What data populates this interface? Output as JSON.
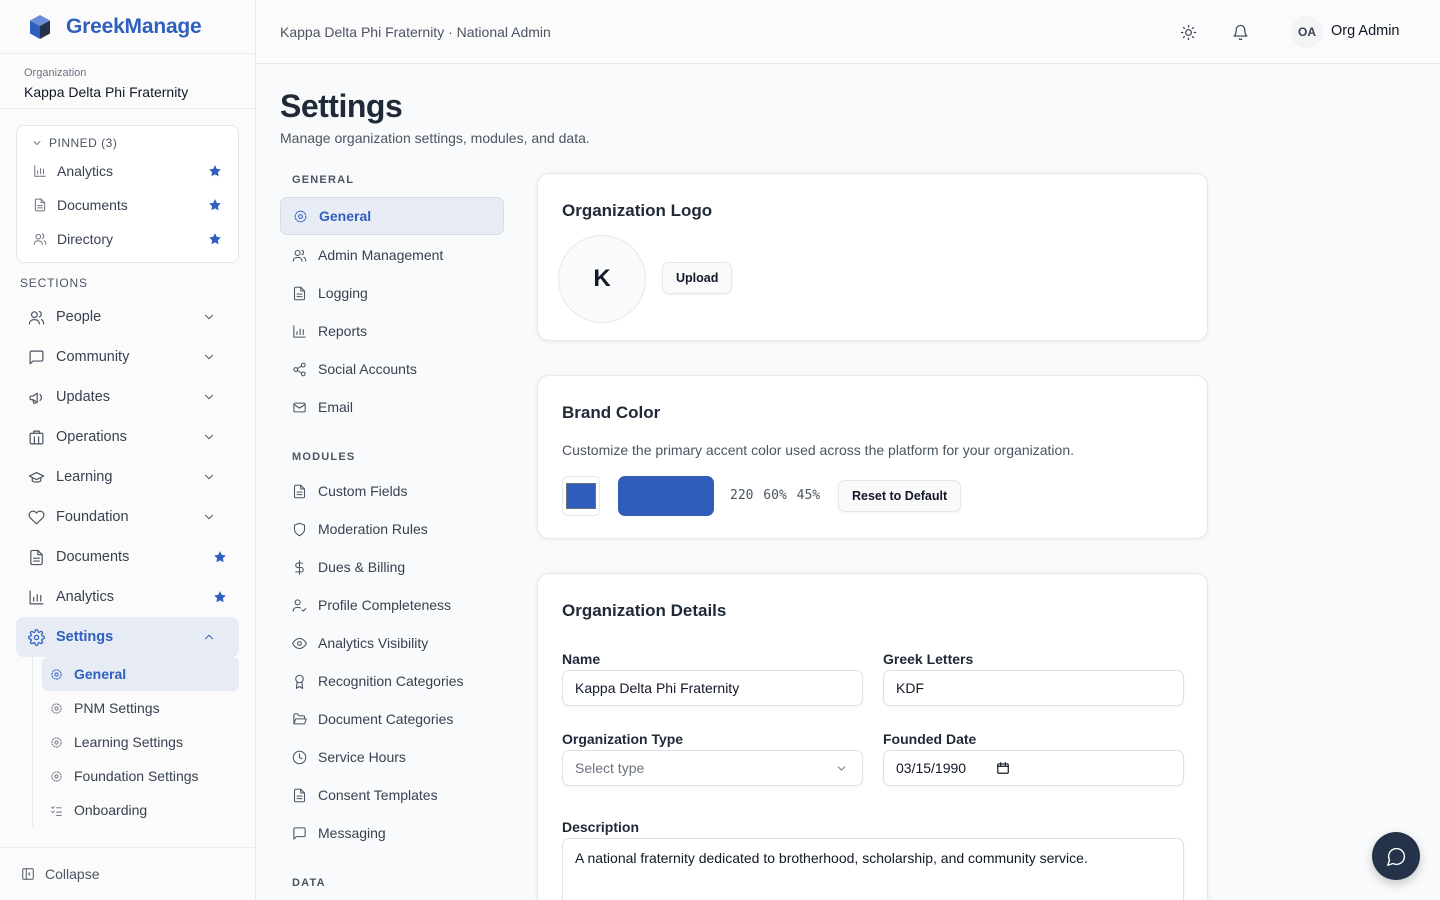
{
  "app": {
    "name": "GreekManage"
  },
  "org": {
    "label": "Organization",
    "name": "Kappa Delta Phi Fraternity"
  },
  "pinned": {
    "header": "PINNED (3)",
    "items": [
      {
        "label": "Analytics",
        "icon": "bar-chart-icon"
      },
      {
        "label": "Documents",
        "icon": "file-icon"
      },
      {
        "label": "Directory",
        "icon": "users-icon"
      }
    ]
  },
  "sidebar": {
    "sections_label": "SECTIONS",
    "items": [
      {
        "label": "People"
      },
      {
        "label": "Community"
      },
      {
        "label": "Updates"
      },
      {
        "label": "Operations"
      },
      {
        "label": "Learning"
      },
      {
        "label": "Foundation"
      },
      {
        "label": "Documents"
      },
      {
        "label": "Analytics"
      },
      {
        "label": "Settings"
      }
    ],
    "settings_sub": [
      {
        "label": "General"
      },
      {
        "label": "PNM Settings"
      },
      {
        "label": "Learning Settings"
      },
      {
        "label": "Foundation Settings"
      },
      {
        "label": "Onboarding"
      }
    ],
    "collapse_label": "Collapse"
  },
  "topbar": {
    "breadcrumb": "Kappa Delta Phi Fraternity · National Admin",
    "avatar_initials": "OA",
    "user_name": "Org Admin"
  },
  "page": {
    "title": "Settings",
    "subtitle": "Manage organization settings, modules, and data."
  },
  "settings_nav": {
    "general_label": "GENERAL",
    "general": [
      "General",
      "Admin Management",
      "Logging",
      "Reports",
      "Social Accounts",
      "Email"
    ],
    "modules_label": "MODULES",
    "modules": [
      "Custom Fields",
      "Moderation Rules",
      "Dues & Billing",
      "Profile Completeness",
      "Analytics Visibility",
      "Recognition Categories",
      "Document Categories",
      "Service Hours",
      "Consent Templates",
      "Messaging"
    ],
    "data_label": "DATA"
  },
  "logo_card": {
    "title": "Organization Logo",
    "initial": "K",
    "upload_label": "Upload"
  },
  "brand_card": {
    "title": "Brand Color",
    "description": "Customize the primary accent color used across the platform for your organization.",
    "hsl": "220 60% 45%",
    "color": "#2e5cb8",
    "reset_label": "Reset to Default"
  },
  "details_card": {
    "title": "Organization Details",
    "name_label": "Name",
    "name_value": "Kappa Delta Phi Fraternity",
    "greek_label": "Greek Letters",
    "greek_value": "KDF",
    "type_label": "Organization Type",
    "type_placeholder": "Select type",
    "founded_label": "Founded Date",
    "founded_value": "03/15/1990",
    "description_label": "Description",
    "description_value": "A national fraternity dedicated to brotherhood, scholarship, and community service."
  },
  "colors": {
    "accent": "#2f5fbf",
    "fab": "#24324a"
  }
}
